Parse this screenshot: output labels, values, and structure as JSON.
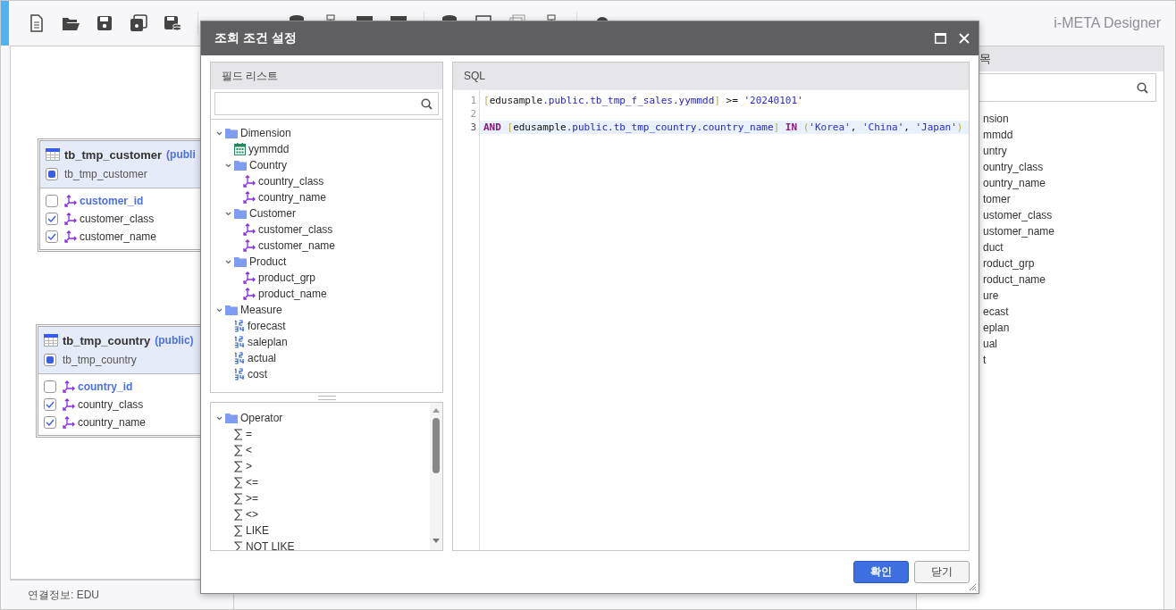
{
  "app": {
    "title": "i-META Designer"
  },
  "tables": [
    {
      "name": "tb_tmp_customer",
      "schema": "(publi",
      "alias": "tb_tmp_customer",
      "indeterminate": true,
      "columns": [
        {
          "name": "customer_id",
          "checked": false,
          "primary_key": true
        },
        {
          "name": "customer_class",
          "checked": true,
          "primary_key": false
        },
        {
          "name": "customer_name",
          "checked": true,
          "primary_key": false
        }
      ]
    },
    {
      "name": "tb_tmp_country",
      "schema": "(public)",
      "alias": "tb_tmp_country",
      "indeterminate": true,
      "columns": [
        {
          "name": "country_id",
          "checked": false,
          "primary_key": true
        },
        {
          "name": "country_class",
          "checked": true,
          "primary_key": false
        },
        {
          "name": "country_name",
          "checked": true,
          "primary_key": false
        }
      ]
    }
  ],
  "right_panel": {
    "title": "목",
    "items": [
      "nsion",
      "mmdd",
      "untry",
      "ountry_class",
      "ountry_name",
      "tomer",
      "ustomer_class",
      "ustomer_name",
      "duct",
      "roduct_grp",
      "roduct_name",
      "ure",
      "ecast",
      "eplan",
      "ual",
      "t"
    ]
  },
  "status_bar": {
    "connection": "연결정보: EDU"
  },
  "dialog": {
    "title": "조회 조건 설정",
    "field_list": {
      "title": "필드 리스트",
      "tree": [
        {
          "label": "Dimension",
          "kind": "folder",
          "expanded": true,
          "children": [
            {
              "label": "yymmdd",
              "kind": "date"
            },
            {
              "label": "Country",
              "kind": "folder",
              "expanded": true,
              "children": [
                {
                  "label": "country_class",
                  "kind": "dimension"
                },
                {
                  "label": "country_name",
                  "kind": "dimension"
                }
              ]
            },
            {
              "label": "Customer",
              "kind": "folder",
              "expanded": true,
              "children": [
                {
                  "label": "customer_class",
                  "kind": "dimension"
                },
                {
                  "label": "customer_name",
                  "kind": "dimension"
                }
              ]
            },
            {
              "label": "Product",
              "kind": "folder",
              "expanded": true,
              "children": [
                {
                  "label": "product_grp",
                  "kind": "dimension"
                },
                {
                  "label": "product_name",
                  "kind": "dimension"
                }
              ]
            }
          ]
        },
        {
          "label": "Measure",
          "kind": "folder",
          "expanded": true,
          "children": [
            {
              "label": "forecast",
              "kind": "measure"
            },
            {
              "label": "saleplan",
              "kind": "measure"
            },
            {
              "label": "actual",
              "kind": "measure"
            },
            {
              "label": "cost",
              "kind": "measure"
            }
          ]
        }
      ]
    },
    "operators": {
      "tree": [
        {
          "label": "Operator",
          "kind": "folder",
          "expanded": true,
          "children": [
            {
              "label": "=",
              "kind": "operator"
            },
            {
              "label": "<",
              "kind": "operator"
            },
            {
              "label": ">",
              "kind": "operator"
            },
            {
              "label": "<=",
              "kind": "operator"
            },
            {
              "label": ">=",
              "kind": "operator"
            },
            {
              "label": "<>",
              "kind": "operator"
            },
            {
              "label": "LIKE",
              "kind": "operator"
            },
            {
              "label": "NOT LIKE",
              "kind": "operator"
            }
          ]
        }
      ]
    },
    "sql": {
      "title": "SQL",
      "lines": [
        {
          "number": "1",
          "current": false,
          "tokens": [
            {
              "kind": "bracket",
              "text": "["
            },
            {
              "kind": "ident",
              "text": "edusample"
            },
            {
              "kind": "path",
              "text": ".public.tb_tmp_f_sales.yymmdd"
            },
            {
              "kind": "bracket",
              "text": "]"
            },
            {
              "kind": "ident",
              "text": " >= "
            },
            {
              "kind": "string",
              "text": "'20240101'"
            }
          ]
        },
        {
          "number": "2",
          "current": false
        },
        {
          "number": "3",
          "current": true,
          "tokens": [
            {
              "kind": "keyword",
              "text": "AND "
            },
            {
              "kind": "bracket",
              "text": "["
            },
            {
              "kind": "ident",
              "text": "edusample"
            },
            {
              "kind": "path",
              "text": ".public.tb_tmp_country.country_name"
            },
            {
              "kind": "bracket",
              "text": "]"
            },
            {
              "kind": "keyword",
              "text": " IN "
            },
            {
              "kind": "bracket",
              "text": "("
            },
            {
              "kind": "string",
              "text": "'Korea'"
            },
            {
              "kind": "ident",
              "text": ", "
            },
            {
              "kind": "string",
              "text": "'China'"
            },
            {
              "kind": "ident",
              "text": ", "
            },
            {
              "kind": "string",
              "text": "'Japan'"
            },
            {
              "kind": "bracket",
              "text": ")"
            }
          ]
        }
      ]
    },
    "buttons": [
      {
        "label": "확인",
        "kind": "primary"
      },
      {
        "label": "닫기",
        "kind": "secondary"
      }
    ]
  }
}
